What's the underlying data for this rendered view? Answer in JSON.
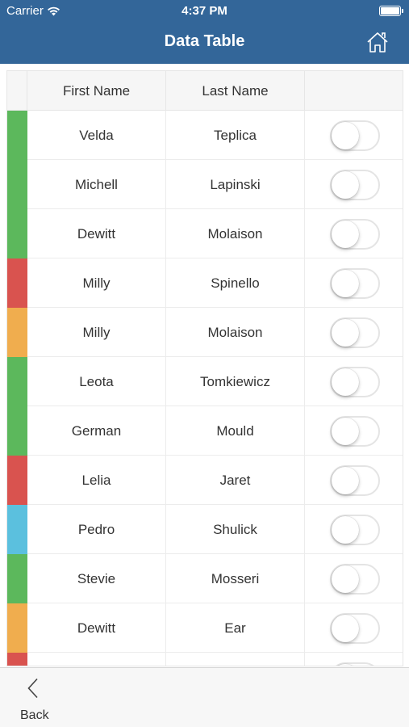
{
  "status": {
    "carrier": "Carrier",
    "time": "4:37 PM"
  },
  "nav": {
    "title": "Data Table",
    "home_icon": "home-icon"
  },
  "table": {
    "columns": [
      "First Name",
      "Last Name"
    ],
    "rows": [
      {
        "first": "Velda",
        "last": "Teplica",
        "flag": "#5cb85c",
        "enabled": false
      },
      {
        "first": "Michell",
        "last": "Lapinski",
        "flag": "#5cb85c",
        "enabled": false
      },
      {
        "first": "Dewitt",
        "last": "Molaison",
        "flag": "#5cb85c",
        "enabled": false
      },
      {
        "first": "Milly",
        "last": "Spinello",
        "flag": "#d9534f",
        "enabled": false
      },
      {
        "first": "Milly",
        "last": "Molaison",
        "flag": "#f0ad4e",
        "enabled": false
      },
      {
        "first": "Leota",
        "last": "Tomkiewicz",
        "flag": "#5cb85c",
        "enabled": false
      },
      {
        "first": "German",
        "last": "Mould",
        "flag": "#5cb85c",
        "enabled": false
      },
      {
        "first": "Lelia",
        "last": "Jaret",
        "flag": "#d9534f",
        "enabled": false
      },
      {
        "first": "Pedro",
        "last": "Shulick",
        "flag": "#5bc0de",
        "enabled": false
      },
      {
        "first": "Stevie",
        "last": "Mosseri",
        "flag": "#5cb85c",
        "enabled": false
      },
      {
        "first": "Dewitt",
        "last": "Ear",
        "flag": "#f0ad4e",
        "enabled": false
      },
      {
        "first": "",
        "last": "",
        "flag": "#d9534f",
        "enabled": false
      }
    ]
  },
  "toolbar": {
    "back_label": "Back",
    "back_icon": "chevron-left-icon"
  }
}
